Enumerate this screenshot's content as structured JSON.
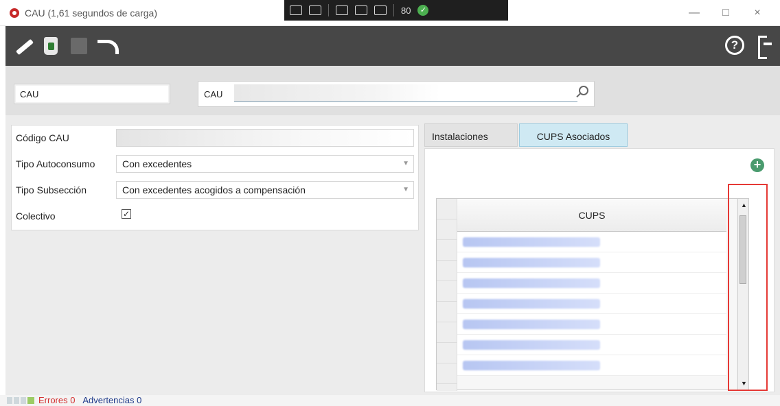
{
  "window": {
    "title": "CAU (1,61 segundos de carga)",
    "overlay_text": "80",
    "controls": {
      "minimize": "—",
      "maximize": "□",
      "close": "×"
    }
  },
  "toolbar": {
    "items": [
      {
        "name": "edit-icon"
      },
      {
        "name": "trash-icon"
      },
      {
        "name": "save-icon"
      },
      {
        "name": "undo-icon"
      }
    ],
    "help_label": "?",
    "exit_icon": "exit-icon"
  },
  "search": {
    "left_label": "CAU",
    "label": "CAU",
    "placeholder": ""
  },
  "form": {
    "codigo_cau": {
      "label": "Código CAU",
      "value": ""
    },
    "tipo_autoconsumo": {
      "label": "Tipo Autoconsumo",
      "value": "Con excedentes"
    },
    "tipo_subseccion": {
      "label": "Tipo Subsección",
      "value": "Con excedentes acogidos a compensación"
    },
    "colectivo": {
      "label": "Colectivo",
      "checked": "✓"
    }
  },
  "tabs": {
    "instalaciones": "Instalaciones",
    "cups_asociados": "CUPS Asociados"
  },
  "grid": {
    "column": "CUPS",
    "rows": [
      "",
      "",
      "",
      "",
      "",
      "",
      ""
    ]
  },
  "status": {
    "errors": "Errores 0",
    "warnings": "Advertencias 0"
  }
}
